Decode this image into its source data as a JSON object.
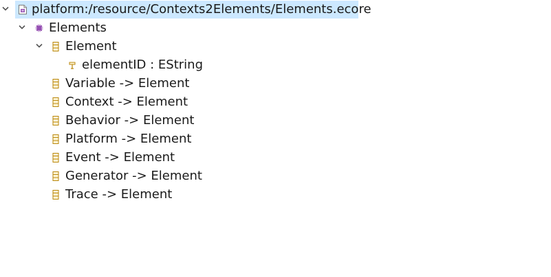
{
  "tree": {
    "root": {
      "label": "platform:/resource/Contexts2Elements/Elements.ecore",
      "icon": "ecore-file-icon",
      "expanded": true
    },
    "package": {
      "label": "Elements",
      "icon": "epackage-icon",
      "expanded": true
    },
    "element": {
      "label": "Element",
      "icon": "eclass-icon",
      "expanded": true,
      "attribute": {
        "label": "elementID : EString",
        "icon": "eattribute-icon"
      }
    },
    "classes": [
      {
        "label": "Variable -> Element",
        "icon": "eclass-icon"
      },
      {
        "label": "Context -> Element",
        "icon": "eclass-icon"
      },
      {
        "label": "Behavior -> Element",
        "icon": "eclass-icon"
      },
      {
        "label": "Platform -> Element",
        "icon": "eclass-icon"
      },
      {
        "label": "Event -> Element",
        "icon": "eclass-icon"
      },
      {
        "label": "Generator -> Element",
        "icon": "eclass-icon"
      },
      {
        "label": "Trace -> Element",
        "icon": "eclass-icon"
      }
    ]
  },
  "colors": {
    "selection": "#cce8ff",
    "eclass_icon": "#b8860b",
    "epackage_icon": "#8e44ad",
    "eattribute_icon": "#b8860b"
  }
}
